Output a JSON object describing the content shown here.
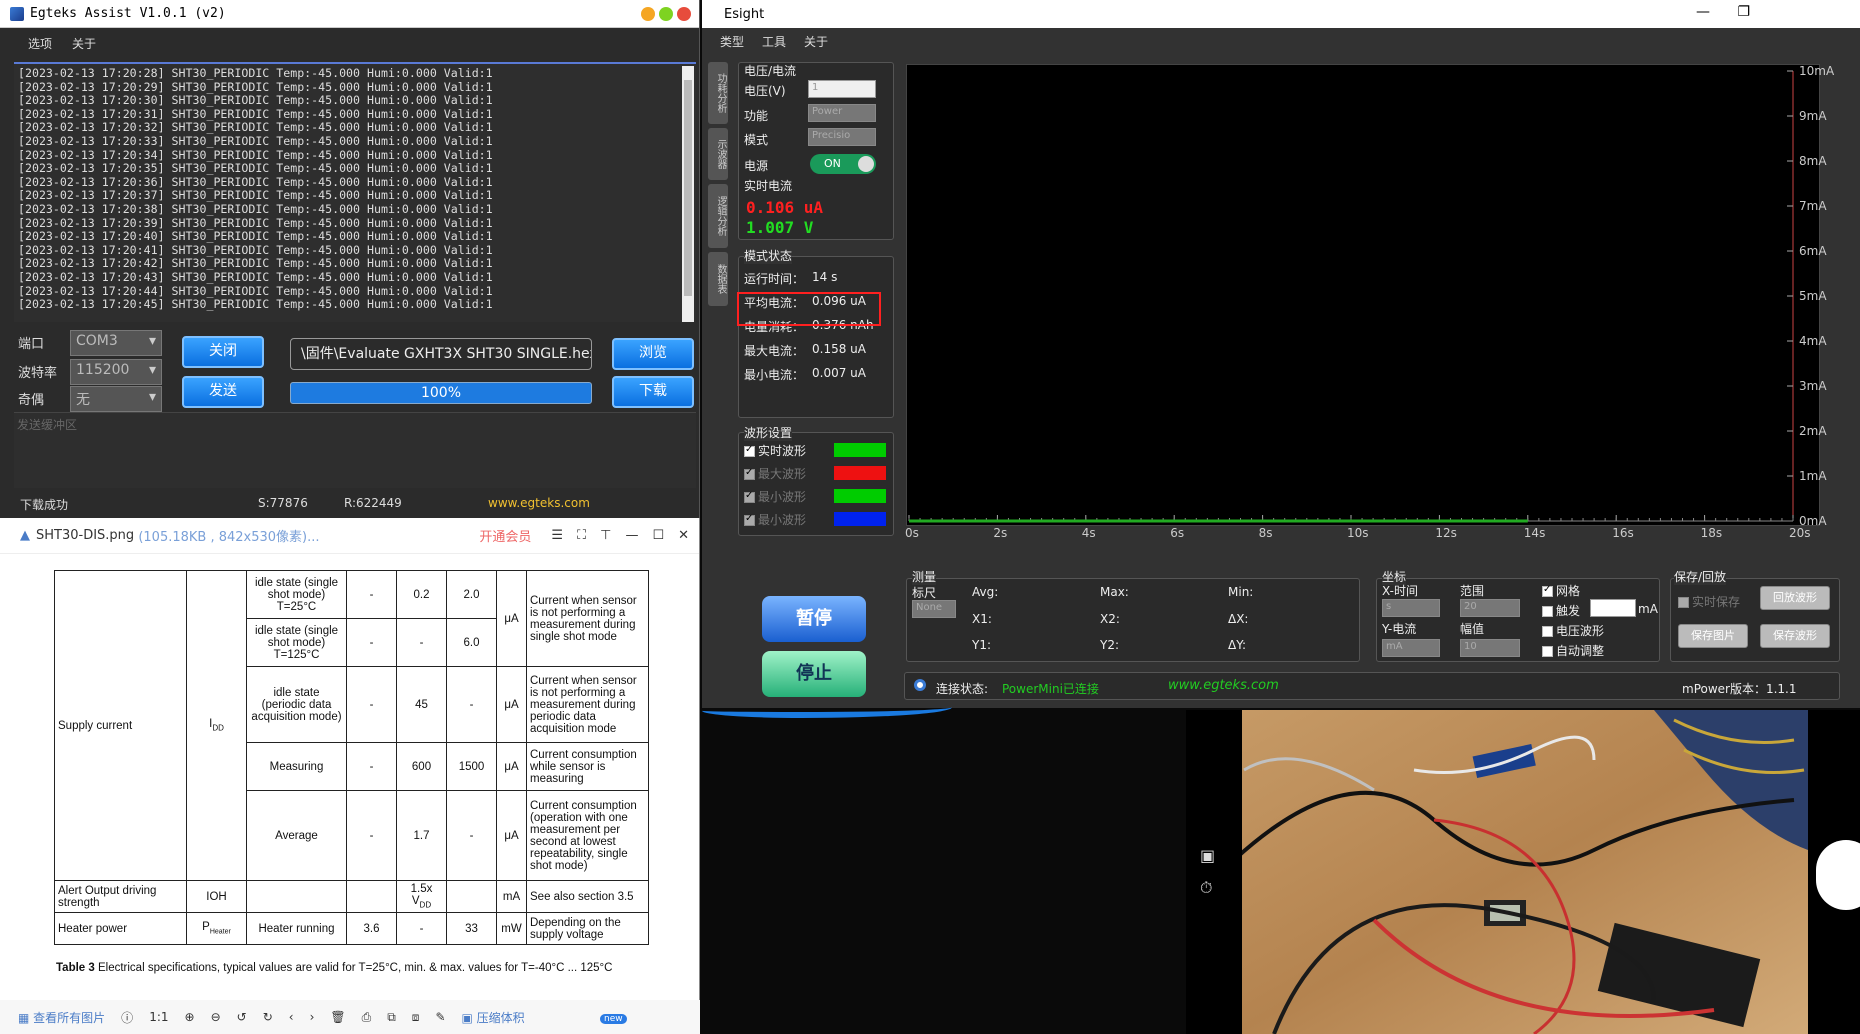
{
  "egteks": {
    "title": "Egteks Assist   V1.0.1 (v2)",
    "menu": [
      "选项",
      "关于"
    ],
    "log": [
      "[2023-02-13 17:20:28] SHT30_PERIODIC Temp:-45.000 Humi:0.000 Valid:1",
      "[2023-02-13 17:20:29] SHT30_PERIODIC Temp:-45.000 Humi:0.000 Valid:1",
      "[2023-02-13 17:20:30] SHT30_PERIODIC Temp:-45.000 Humi:0.000 Valid:1",
      "[2023-02-13 17:20:31] SHT30_PERIODIC Temp:-45.000 Humi:0.000 Valid:1",
      "[2023-02-13 17:20:32] SHT30_PERIODIC Temp:-45.000 Humi:0.000 Valid:1",
      "[2023-02-13 17:20:33] SHT30_PERIODIC Temp:-45.000 Humi:0.000 Valid:1",
      "[2023-02-13 17:20:34] SHT30_PERIODIC Temp:-45.000 Humi:0.000 Valid:1",
      "[2023-02-13 17:20:35] SHT30_PERIODIC Temp:-45.000 Humi:0.000 Valid:1",
      "[2023-02-13 17:20:36] SHT30_PERIODIC Temp:-45.000 Humi:0.000 Valid:1",
      "[2023-02-13 17:20:37] SHT30_PERIODIC Temp:-45.000 Humi:0.000 Valid:1",
      "[2023-02-13 17:20:38] SHT30_PERIODIC Temp:-45.000 Humi:0.000 Valid:1",
      "[2023-02-13 17:20:39] SHT30_PERIODIC Temp:-45.000 Humi:0.000 Valid:1",
      "[2023-02-13 17:20:40] SHT30_PERIODIC Temp:-45.000 Humi:0.000 Valid:1",
      "[2023-02-13 17:20:41] SHT30_PERIODIC Temp:-45.000 Humi:0.000 Valid:1",
      "[2023-02-13 17:20:42] SHT30_PERIODIC Temp:-45.000 Humi:0.000 Valid:1",
      "[2023-02-13 17:20:43] SHT30_PERIODIC Temp:-45.000 Humi:0.000 Valid:1",
      "[2023-02-13 17:20:44] SHT30_PERIODIC Temp:-45.000 Humi:0.000 Valid:1",
      "[2023-02-13 17:20:45] SHT30_PERIODIC Temp:-45.000 Humi:0.000 Valid:1"
    ],
    "port_label": "端口",
    "port_value": "COM3",
    "baud_label": "波特率",
    "baud_value": "115200",
    "parity_label": "奇偶",
    "parity_value": "无",
    "close_btn": "关闭",
    "send_btn": "发送",
    "file_path": "\\固件\\Evaluate GXHT3X SHT30 SINGLE.hex",
    "progress_text": "100%",
    "progress": 1.0,
    "browse_btn": "浏览",
    "download_btn": "下载",
    "send_buffer_placeholder": "发送缓冲区",
    "status_text": "下载成功",
    "s_count": "S:77876",
    "r_count": "R:622449",
    "website": "www.egteks.com"
  },
  "viewer": {
    "filename": "SHT30-DIS.png",
    "fileinfo": "(105.18KB , 842x530像素)...",
    "vip": "开通会员",
    "table": {
      "supply_current": "Supply current",
      "idd": "I",
      "idd_sub": "DD",
      "rows": [
        {
          "cond": "idle state (single shot mode) T=25°C",
          "min": "-",
          "typ": "0.2",
          "max": "2.0",
          "comment": "Current when sensor is not performing a measurement during single shot mode"
        },
        {
          "cond": "idle state (single shot mode) T=125°C",
          "min": "-",
          "typ": "-",
          "max": "6.0",
          "comment": ""
        },
        {
          "cond": "idle state (periodic data acquisition mode)",
          "min": "-",
          "typ": "45",
          "max": "-",
          "unit": "μA",
          "comment": "Current when sensor is not performing a measurement during periodic data acquisition mode"
        },
        {
          "cond": "Measuring",
          "min": "-",
          "typ": "600",
          "max": "1500",
          "unit": "μA",
          "comment": "Current consumption while sensor is measuring"
        },
        {
          "cond": "Average",
          "min": "-",
          "typ": "1.7",
          "max": "-",
          "unit": "μA",
          "comment": "Current consumption (operation with one measurement per second at lowest repeatability, single shot mode)"
        }
      ],
      "unit_ua": "μA",
      "alert_label": "Alert Output driving strength",
      "alert_sym": "IOH",
      "alert_typ": "1.5x V",
      "alert_typ_sub": "DD",
      "alert_unit": "mA",
      "alert_comment": "See also section 3.5",
      "heater_label": "Heater power",
      "heater_sym": "P",
      "heater_sym_sub": "Heater",
      "heater_cond": "Heater running",
      "heater_min": "3.6",
      "heater_typ": "-",
      "heater_max": "33",
      "heater_unit": "mW",
      "heater_comment": "Depending on the supply voltage"
    },
    "caption_bold": "Table 3",
    "caption": " Electrical specifications, typical values are valid for T=25°C, min. & max. values for T=-40°C ... 125°C",
    "footer": [
      "查看所有图片",
      "压缩体积"
    ],
    "new_badge": "new"
  },
  "esight": {
    "title": "Esight",
    "menu": [
      "类型",
      "工具",
      "关于"
    ],
    "side_tabs": [
      "功耗分析",
      "示波器",
      "逻辑分析",
      "数据表"
    ],
    "vi": {
      "title": "电压/电流",
      "voltage_label": "电压(V)",
      "voltage_value": "1",
      "func_label": "功能",
      "func_value": "Power",
      "mode_label": "模式",
      "mode_value": "Precisio",
      "power_label": "电源",
      "power_value": "ON",
      "realtime_label": "实时电流",
      "current": "0.106 uA",
      "voltage": "1.007 V"
    },
    "state": {
      "title": "模式状态",
      "rows": [
        {
          "label": "运行时间：",
          "value": "14 s"
        },
        {
          "label": "平均电流：",
          "value": "0.096 uA"
        },
        {
          "label": "电量消耗：",
          "value": "0.376 nAh"
        },
        {
          "label": "最大电流：",
          "value": "0.158 uA"
        },
        {
          "label": "最小电流：",
          "value": "0.007 uA"
        }
      ]
    },
    "wave": {
      "title": "波形设置",
      "items": [
        {
          "label": "实时波形",
          "color": "#00cc00",
          "checked": true,
          "enabled": true
        },
        {
          "label": "最大波形",
          "color": "#ee1111",
          "checked": true,
          "enabled": false
        },
        {
          "label": "最小波形",
          "color": "#00cc00",
          "checked": true,
          "enabled": false
        },
        {
          "label": "最小波形",
          "color": "#0022ee",
          "checked": true,
          "enabled": false
        }
      ]
    },
    "pause_btn": "暂停",
    "stop_btn": "停止",
    "measure": {
      "title": "测量",
      "ruler_label": "标尺",
      "ruler_value": "None",
      "avg": "Avg:",
      "max": "Max:",
      "min": "Min:",
      "x1": "X1:",
      "x2": "X2:",
      "dx": "ΔX:",
      "y1": "Y1:",
      "y2": "Y2:",
      "dy": "ΔY:"
    },
    "coord": {
      "title": "坐标",
      "x_label": "X-时间",
      "x_value": "s",
      "range_label": "范围",
      "range_value": "20",
      "y_label": "Y-电流",
      "y_value": "mA",
      "amp_label": "幅值",
      "amp_value": "10",
      "grid": "网格",
      "trigger": "触发",
      "trigger_unit": "mA",
      "voltage_wave": "电压波形",
      "auto_adjust": "自动调整"
    },
    "save": {
      "title": "保存/回放",
      "realtime_save": "实时保存",
      "replay": "回放波形",
      "save_img": "保存图片",
      "save_wave": "保存波形"
    },
    "conn_label": "连接状态:",
    "conn_value": "PowerMini已连接",
    "website": "www.egteks.com",
    "version": "mPower版本：1.1.1"
  },
  "chart_data": {
    "type": "line",
    "xlabel": "",
    "ylabel": "",
    "x_ticks": [
      "0s",
      "2s",
      "4s",
      "6s",
      "8s",
      "10s",
      "12s",
      "14s",
      "16s",
      "18s",
      "20s"
    ],
    "y_ticks": [
      "0mA",
      "1mA",
      "2mA",
      "3mA",
      "4mA",
      "5mA",
      "6mA",
      "7mA",
      "8mA",
      "9mA",
      "10mA"
    ],
    "xlim": [
      0,
      20
    ],
    "ylim": [
      0,
      10
    ],
    "grid": false,
    "series": [
      {
        "color": "#22aa22",
        "x": [
          0,
          14
        ],
        "y": [
          0.0001,
          0.0001
        ]
      }
    ]
  },
  "colors": {
    "accent": "#0a6fe0",
    "green": "#00cc00",
    "red": "#ee1111",
    "highlight": "#ff2020"
  }
}
